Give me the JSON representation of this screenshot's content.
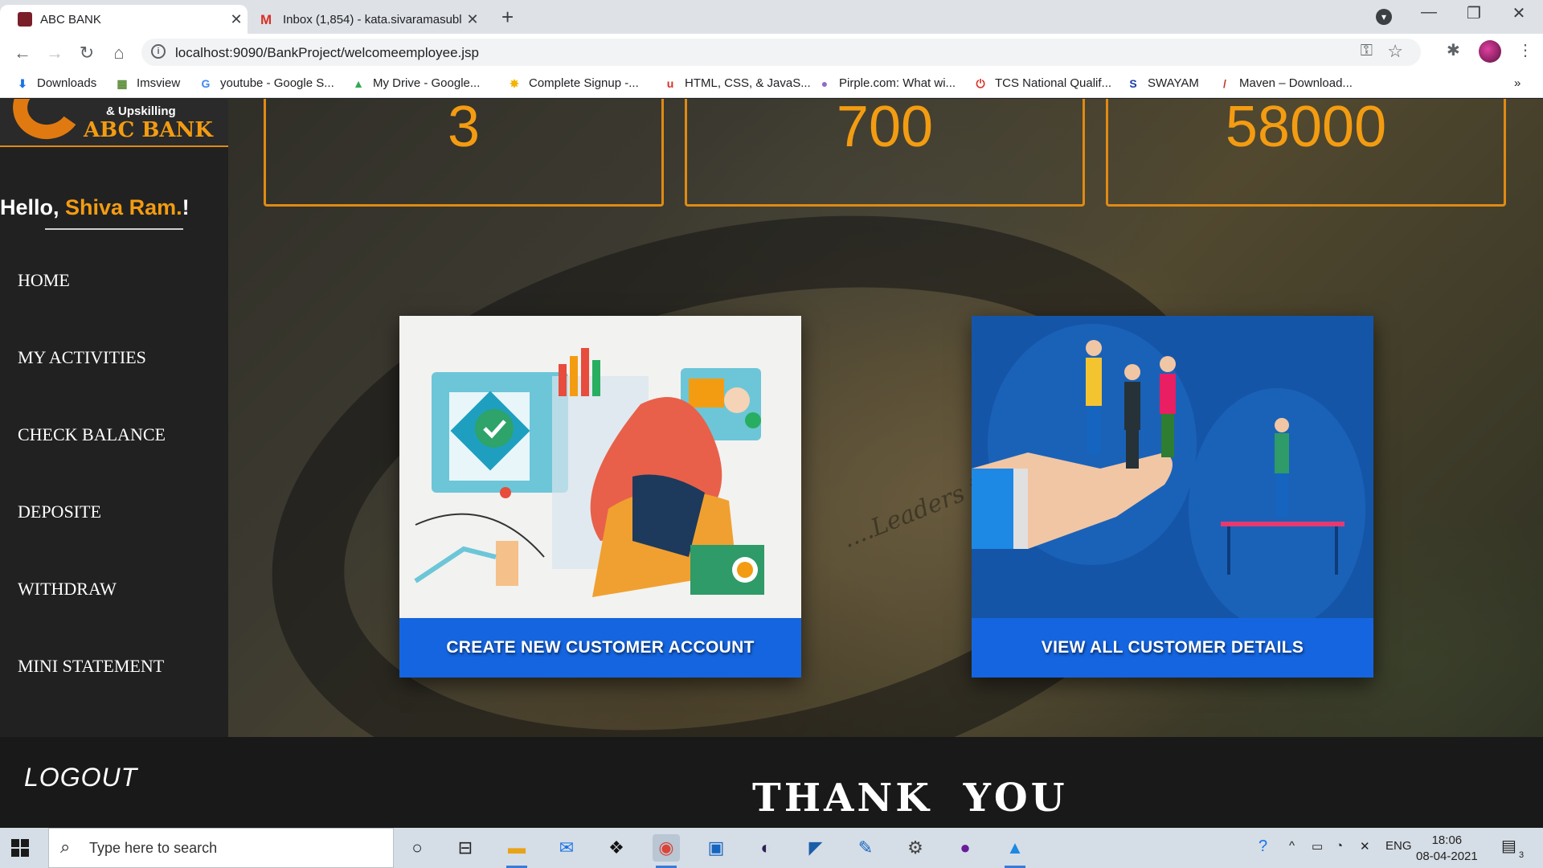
{
  "browser": {
    "tabs": [
      {
        "title": "ABC BANK",
        "active": true
      },
      {
        "title": "Inbox (1,854) - kata.sivaramasubl",
        "active": false
      }
    ],
    "url": "localhost:9090/BankProject/welcomeemployee.jsp",
    "bookmarks": [
      "Downloads",
      "Imsview",
      "youtube - Google S...",
      "My Drive - Google...",
      "Complete Signup -...",
      "HTML, CSS, & JavaS...",
      "Pirple.com: What wi...",
      "TCS National Qualif...",
      "SWAYAM",
      "Maven – Download..."
    ],
    "overflow": "»"
  },
  "sidebar": {
    "logo_tagline": "& Upskilling",
    "logo_name": "ABC BANK",
    "greeting": "Hello,",
    "user_name": "Shiva Ram.",
    "greeting_end": "!",
    "menu": [
      "HOME",
      "MY ACTIVITIES",
      "CHECK BALANCE",
      "DEPOSITE",
      "WITHDRAW",
      "MINI STATEMENT"
    ]
  },
  "stats": [
    "3",
    "700",
    "58000"
  ],
  "cards": [
    {
      "label": "CREATE NEW CUSTOMER ACCOUNT"
    },
    {
      "label": "VIEW ALL CUSTOMER DETAILS"
    }
  ],
  "hero_tagline": "....Leaders in Tech",
  "footer": {
    "logout": "LOGOUT",
    "thanks": "THANK YOU"
  },
  "taskbar": {
    "search_placeholder": "Type here to search",
    "language": "ENG",
    "time": "18:06",
    "date": "08-04-2021",
    "notifications": "3"
  },
  "colors": {
    "accent": "#f39c12",
    "button": "#1565e0",
    "sidebar": "#212121"
  }
}
